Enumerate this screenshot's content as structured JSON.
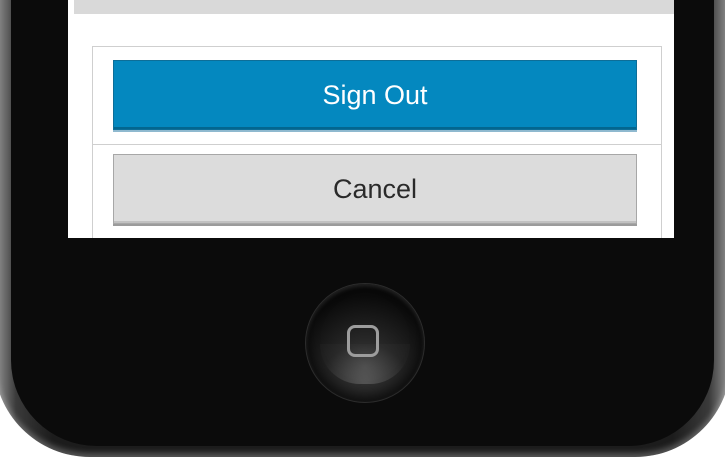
{
  "sheet": {
    "signout_label": "Sign Out",
    "cancel_label": "Cancel"
  },
  "colors": {
    "primary_button": "#0488bf",
    "secondary_button": "#dcdcdc",
    "phone_body": "#0b0b0b"
  },
  "icons": {
    "home": "home-square-icon"
  }
}
